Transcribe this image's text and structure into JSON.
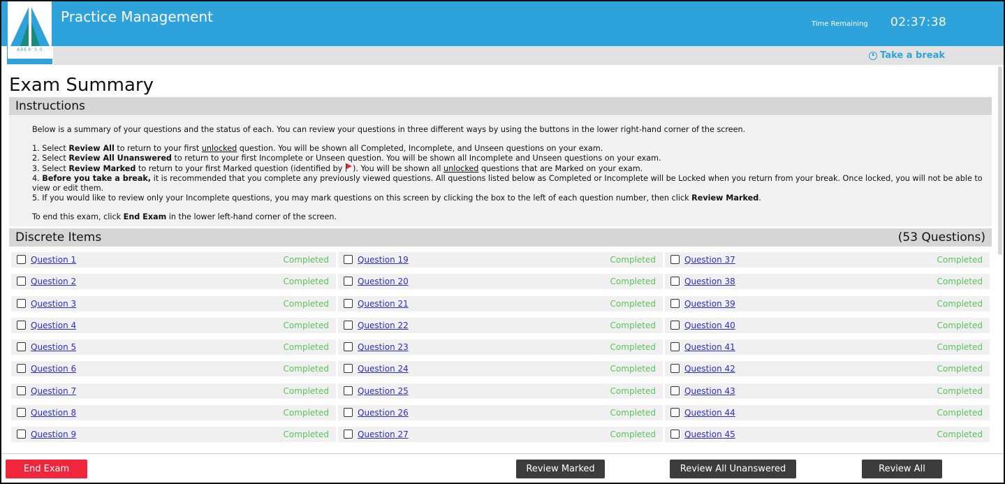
{
  "header": {
    "app_title": "Practice Management",
    "logo_text": "ARE® 5.0",
    "time_label": "Time Remaining",
    "time_value": "02:37:38",
    "break_label": "Take a break",
    "colors": {
      "brand": "#2ea3db",
      "end": "#f0263d",
      "dark_button": "#3c3c3c",
      "completed": "#5ac35a"
    }
  },
  "page": {
    "title": "Exam Summary",
    "instructions_heading": "Instructions",
    "intro": "Below is a summary of your questions and the status of each. You can review your questions in three different ways by using the buttons in the lower right-hand corner of the screen.",
    "steps": {
      "s1_a": "1. Select ",
      "s1_b": "Review All",
      "s1_c": " to return to your first ",
      "s1_d": "unlocked",
      "s1_e": " question. You will be shown all Completed, Incomplete, and Unseen questions on your exam.",
      "s2_a": "2. Select ",
      "s2_b": "Review All Unanswered",
      "s2_c": " to return to your first Incomplete or Unseen question. You will be shown all Incomplete and Unseen questions on your exam.",
      "s3_a": "3. Select ",
      "s3_b": "Review Marked",
      "s3_c": " to return to your first Marked question (identified by ",
      "s3_d": "). You will be shown all ",
      "s3_e": "unlocked",
      "s3_f": " questions that are Marked on your exam.",
      "s4_a": "4. ",
      "s4_b": "Before you take a break,",
      "s4_c": " it is recommended that you complete any previously viewed questions. All questions listed below as Completed or Incomplete will be Locked when you return from your break. Once locked, you will not be able to view or edit them.",
      "s5_a": "5. If you would like to review only your Incomplete questions, you may mark questions on this screen by clicking the box to the left of each question number, then click ",
      "s5_b": "Review Marked",
      "s5_c": ".",
      "end_a": "To end this exam, click ",
      "end_b": "End Exam",
      "end_c": " in the lower left-hand corner of the screen."
    },
    "section_title": "Discrete Items",
    "section_count": "(53 Questions)"
  },
  "questions": {
    "col1": [
      {
        "label": "Question 1",
        "status": "Completed"
      },
      {
        "label": "Question 2",
        "status": "Completed"
      },
      {
        "label": "Question 3",
        "status": "Completed"
      },
      {
        "label": "Question 4",
        "status": "Completed"
      },
      {
        "label": "Question 5",
        "status": "Completed"
      },
      {
        "label": "Question 6",
        "status": "Completed"
      },
      {
        "label": "Question 7",
        "status": "Completed"
      },
      {
        "label": "Question 8",
        "status": "Completed"
      },
      {
        "label": "Question 9",
        "status": "Completed"
      }
    ],
    "col2": [
      {
        "label": "Question 19",
        "status": "Completed"
      },
      {
        "label": "Question 20",
        "status": "Completed"
      },
      {
        "label": "Question 21",
        "status": "Completed"
      },
      {
        "label": "Question 22",
        "status": "Completed"
      },
      {
        "label": "Question 23",
        "status": "Completed"
      },
      {
        "label": "Question 24",
        "status": "Completed"
      },
      {
        "label": "Question 25",
        "status": "Completed"
      },
      {
        "label": "Question 26",
        "status": "Completed"
      },
      {
        "label": "Question 27",
        "status": "Completed"
      }
    ],
    "col3": [
      {
        "label": "Question 37",
        "status": "Completed"
      },
      {
        "label": "Question 38",
        "status": "Completed"
      },
      {
        "label": "Question 39",
        "status": "Completed"
      },
      {
        "label": "Question 40",
        "status": "Completed"
      },
      {
        "label": "Question 41",
        "status": "Completed"
      },
      {
        "label": "Question 42",
        "status": "Completed"
      },
      {
        "label": "Question 43",
        "status": "Completed"
      },
      {
        "label": "Question 44",
        "status": "Completed"
      },
      {
        "label": "Question 45",
        "status": "Completed"
      }
    ]
  },
  "footer": {
    "end_exam": "End Exam",
    "review_marked": "Review Marked",
    "review_unanswered": "Review All Unanswered",
    "review_all": "Review All"
  }
}
